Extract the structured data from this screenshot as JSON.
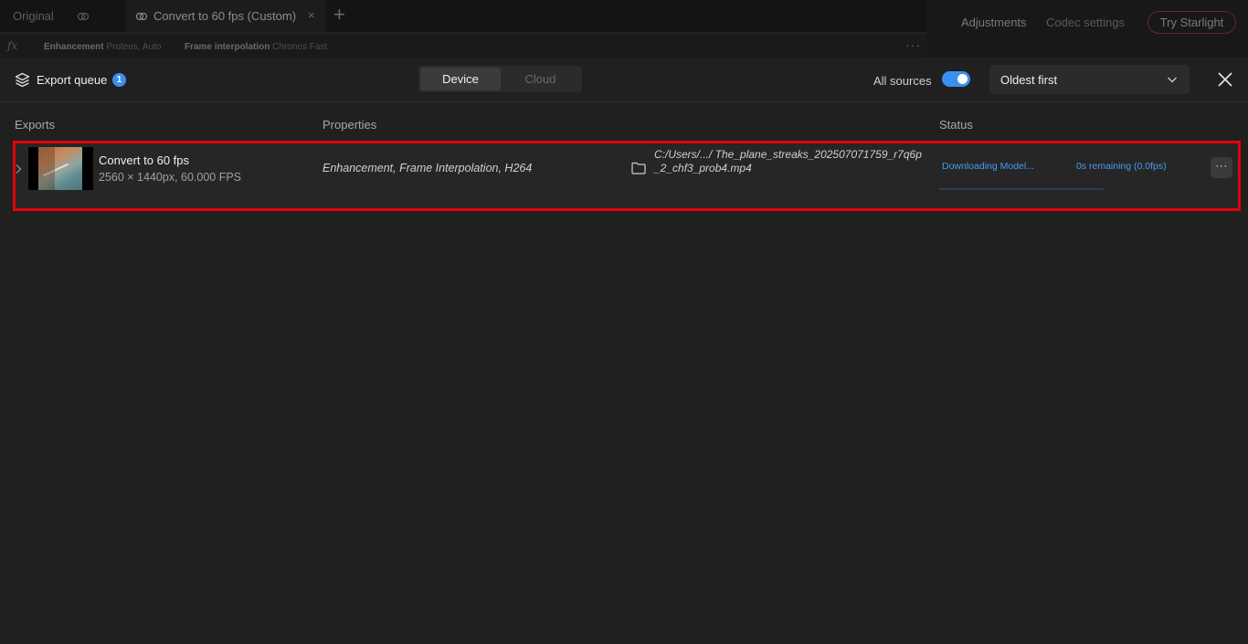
{
  "tabs": {
    "original_label": "Original",
    "active_label": "Convert to 60 fps (Custom)",
    "close_glyph": "×",
    "add_glyph": "+"
  },
  "right_panel": {
    "adjustments_label": "Adjustments",
    "codec_label": "Codec settings",
    "starlight_label": "Try Starlight"
  },
  "filters": {
    "fx_glyph": "fx",
    "items": [
      {
        "name": "Enhancement",
        "value": "Proteus, Auto"
      },
      {
        "name": "Frame interpolation",
        "value": "Chronos Fast"
      }
    ],
    "more_glyph": "···"
  },
  "queue": {
    "title": "Export queue",
    "count": "1",
    "modes": [
      "Device",
      "Cloud"
    ],
    "active_mode": "Device",
    "all_sources_label": "All sources",
    "all_sources_on": true,
    "sort_value": "Oldest first"
  },
  "columns": {
    "exports": "Exports",
    "properties": "Properties",
    "status": "Status"
  },
  "jobs": [
    {
      "title": "Convert to 60 fps",
      "meta": "2560 × 1440px, 60.000 FPS",
      "properties": "Enhancement, Frame Interpolation, H264",
      "path": "C:/Users/.../ The_plane_streaks_202507071759_r7q6p_2_chf3_prob4.mp4",
      "status": "Downloading Model...",
      "remaining": "0s remaining (0.0fps)",
      "progress": 0.0,
      "more_glyph": "···"
    }
  ],
  "colors": {
    "accent": "#3b8ff0",
    "highlight": "#e5000a",
    "background": "#202020"
  }
}
